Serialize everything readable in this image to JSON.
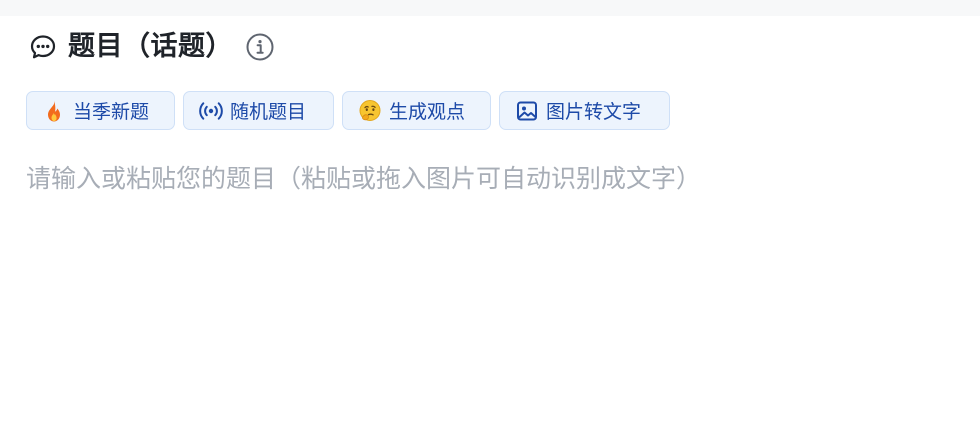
{
  "header": {
    "title": "题目（话题）",
    "icon": "chat-bubble-icon",
    "info_icon": "info-icon"
  },
  "chips": [
    {
      "label": "当季新题",
      "icon": "fire-emoji"
    },
    {
      "label": "随机题目",
      "icon": "broadcast-icon"
    },
    {
      "label": "生成观点",
      "icon": "thinking-face-emoji"
    },
    {
      "label": "图片转文字",
      "icon": "image-icon"
    }
  ],
  "editor": {
    "value": "",
    "placeholder": "请输入或粘贴您的题目（粘贴或拖入图片可自动识别成文字）"
  },
  "colors": {
    "chip_bg": "#edf4fd",
    "chip_border": "#cfe0f7",
    "chip_text": "#1d4aa8",
    "placeholder": "#a7adb6"
  }
}
